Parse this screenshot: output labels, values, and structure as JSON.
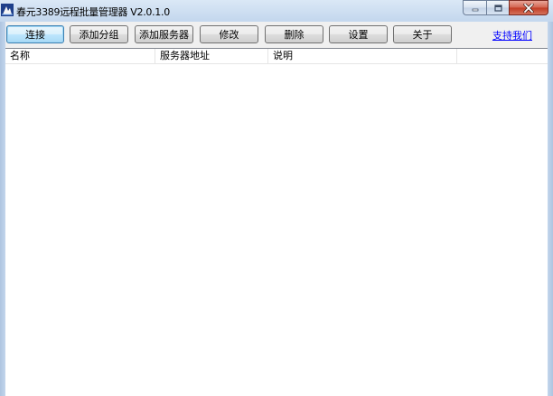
{
  "window": {
    "title": "春元3389远程批量管理器 V2.0.1.0"
  },
  "toolbar": {
    "buttons": [
      {
        "label": "连接"
      },
      {
        "label": "添加分组"
      },
      {
        "label": "添加服务器"
      },
      {
        "label": "修改"
      },
      {
        "label": "删除"
      },
      {
        "label": "设置"
      },
      {
        "label": "关于"
      }
    ],
    "support_link": "支持我们"
  },
  "list": {
    "columns": [
      {
        "label": "名称"
      },
      {
        "label": "服务器地址"
      },
      {
        "label": "说明"
      }
    ],
    "rows": []
  }
}
